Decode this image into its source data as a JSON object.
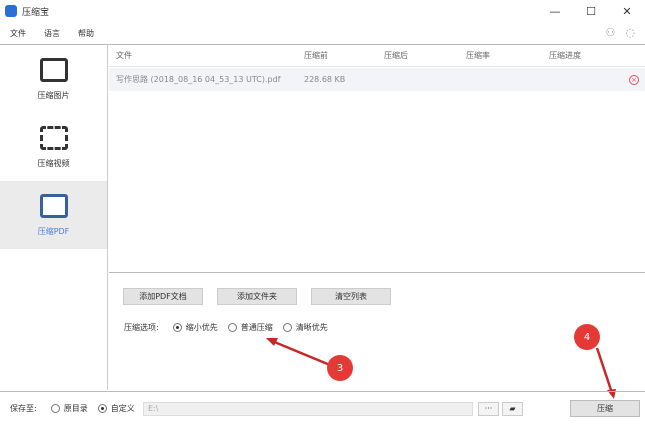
{
  "window": {
    "title": "压缩宝",
    "minimize": "—",
    "maximize": "☐",
    "close": "✕"
  },
  "menu": [
    "文件",
    "语言",
    "帮助"
  ],
  "sidebar": [
    {
      "label": "压缩图片"
    },
    {
      "label": "压缩视频"
    },
    {
      "label": "压缩PDF"
    }
  ],
  "table": {
    "headers": [
      "文件",
      "压缩前",
      "压缩后",
      "压缩率",
      "压缩进度"
    ],
    "rows": [
      {
        "file": "写作思路 (2018_08_16 04_53_13 UTC).pdf",
        "before": "228.68 KB",
        "after": "",
        "ratio": "",
        "progress": ""
      }
    ]
  },
  "buttons": {
    "add_pdf": "添加PDF文档",
    "add_folder": "添加文件夹",
    "clear": "清空列表",
    "compress": "压缩",
    "browse": "···"
  },
  "options": {
    "label": "压缩选项:",
    "items": [
      "缩小优先",
      "普通压缩",
      "清晰优先"
    ],
    "selected": 0
  },
  "save": {
    "label": "保存至:",
    "options": [
      "原目录",
      "自定义"
    ],
    "selected": 1,
    "path": "E:\\"
  },
  "annotations": {
    "badge3": "3",
    "badge4": "4"
  }
}
